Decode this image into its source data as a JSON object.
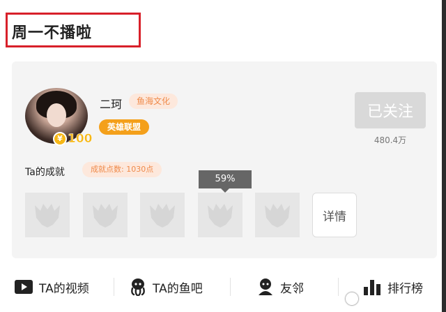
{
  "page_title": "周一不播啦",
  "profile": {
    "username": "二珂",
    "org_tag": "鱼海文化",
    "game_tag": "英雄联盟",
    "level": "100",
    "follow_label": "已关注",
    "follower_count": "480.4万"
  },
  "achievements": {
    "label": "Ta的成就",
    "points": "成就点数: 1030点",
    "tooltip": "59%",
    "detail_label": "详情",
    "count": 5
  },
  "bottom_nav": {
    "videos": "TA的视频",
    "fish_bar": "TA的鱼吧",
    "neighbors": "友邻",
    "ranking": "排行榜"
  },
  "icons": [
    "play-icon",
    "octopus-icon",
    "person-icon",
    "bar-chart-icon"
  ],
  "colors": {
    "accent_orange": "#f4a01b",
    "tag_text": "#ef8a4a",
    "title_border": "#d8202a"
  }
}
